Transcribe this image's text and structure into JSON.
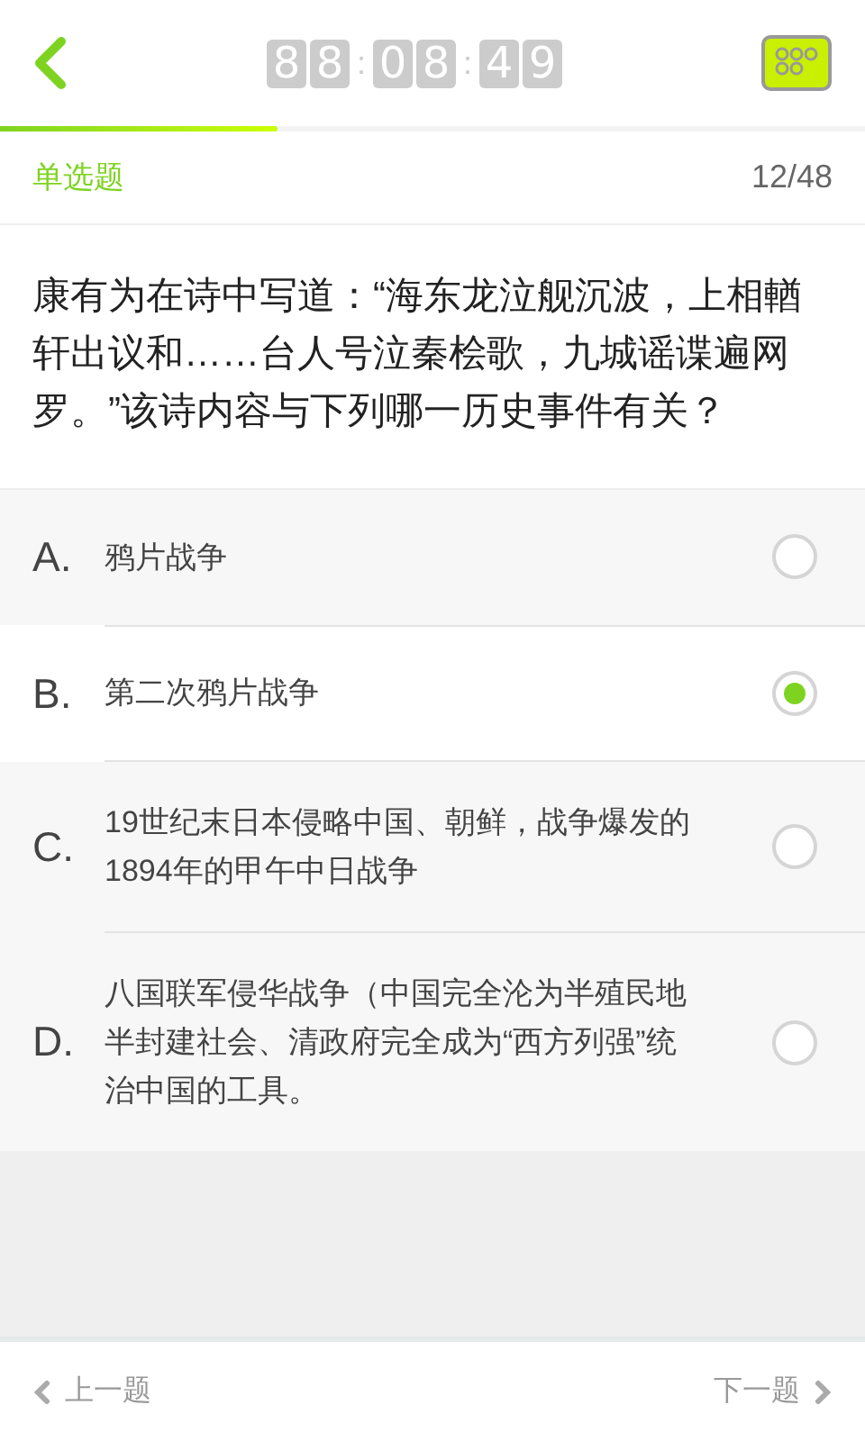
{
  "timer": [
    {
      "kind": "digit",
      "text": "8"
    },
    {
      "kind": "digit",
      "text": "8"
    },
    {
      "kind": "separator",
      "text": ":"
    },
    {
      "kind": "digit",
      "text": "0"
    },
    {
      "kind": "digit",
      "text": "8"
    },
    {
      "kind": "separator",
      "text": ":"
    },
    {
      "kind": "digit",
      "text": "4"
    },
    {
      "kind": "digit",
      "text": "9"
    }
  ],
  "progress": {
    "level": 0.32
  },
  "question_type": "单选题",
  "counter": "12/48",
  "question": "康有为在诗中写道：“海东龙泣舰沉波，上相輶轩出议和……台人号泣秦桧歌，九城谣谍遍网罗。”该诗内容与下列哪一历史事件有关？",
  "options": [
    {
      "letter": "A.",
      "text": "鸦片战争",
      "selected": false
    },
    {
      "letter": "B.",
      "text": "第二次鸦片战争",
      "selected": true
    },
    {
      "letter": "C.",
      "text": "19世纪末日本侵略中国、朝鲜，战争爆发的1894年的甲午中日战争",
      "selected": false
    },
    {
      "letter": "D.",
      "text": "八国联军侵华战争（中国完全沦为半殖民地半封建社会、清政府完全成为“西方列强”统治中国的工具。",
      "selected": false
    }
  ],
  "nav": {
    "prev": "上一题",
    "next": "下一题"
  }
}
